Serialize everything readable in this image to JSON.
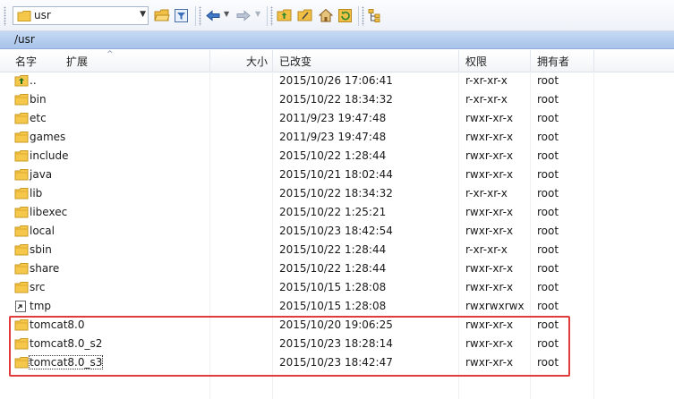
{
  "toolbar": {
    "path_value": "usr",
    "icons": [
      "folder-icon",
      "open-folder-icon",
      "filter-icon",
      "back-icon",
      "forward-icon",
      "parent-folder-icon",
      "root-folder-icon",
      "home-icon",
      "refresh-icon",
      "tree-icon"
    ]
  },
  "pathbar": {
    "path": "/usr"
  },
  "columns": {
    "name": "名字",
    "ext": "扩展",
    "size": "大小",
    "modified": "已改变",
    "perms": "权限",
    "owner": "拥有者"
  },
  "rows": [
    {
      "name": "..",
      "modified": "2015/10/26 17:06:41",
      "perms": "r-xr-xr-x",
      "owner": "root",
      "icon": "parent-folder-icon"
    },
    {
      "name": "bin",
      "modified": "2015/10/22 18:34:32",
      "perms": "r-xr-xr-x",
      "owner": "root",
      "icon": "folder-icon"
    },
    {
      "name": "etc",
      "modified": "2011/9/23 19:47:48",
      "perms": "rwxr-xr-x",
      "owner": "root",
      "icon": "folder-icon"
    },
    {
      "name": "games",
      "modified": "2011/9/23 19:47:48",
      "perms": "rwxr-xr-x",
      "owner": "root",
      "icon": "folder-icon"
    },
    {
      "name": "include",
      "modified": "2015/10/22 1:28:44",
      "perms": "rwxr-xr-x",
      "owner": "root",
      "icon": "folder-icon"
    },
    {
      "name": "java",
      "modified": "2015/10/21 18:02:44",
      "perms": "rwxr-xr-x",
      "owner": "root",
      "icon": "folder-icon"
    },
    {
      "name": "lib",
      "modified": "2015/10/22 18:34:32",
      "perms": "r-xr-xr-x",
      "owner": "root",
      "icon": "folder-icon"
    },
    {
      "name": "libexec",
      "modified": "2015/10/22 1:25:21",
      "perms": "rwxr-xr-x",
      "owner": "root",
      "icon": "folder-icon"
    },
    {
      "name": "local",
      "modified": "2015/10/23 18:42:54",
      "perms": "rwxr-xr-x",
      "owner": "root",
      "icon": "folder-icon"
    },
    {
      "name": "sbin",
      "modified": "2015/10/22 1:28:44",
      "perms": "r-xr-xr-x",
      "owner": "root",
      "icon": "folder-icon"
    },
    {
      "name": "share",
      "modified": "2015/10/22 1:28:44",
      "perms": "rwxr-xr-x",
      "owner": "root",
      "icon": "folder-icon"
    },
    {
      "name": "src",
      "modified": "2015/10/15 1:28:08",
      "perms": "rwxr-xr-x",
      "owner": "root",
      "icon": "folder-icon"
    },
    {
      "name": "tmp",
      "modified": "2015/10/15 1:28:08",
      "perms": "rwxrwxrwx",
      "owner": "root",
      "icon": "link-folder-icon"
    },
    {
      "name": "tomcat8.0",
      "modified": "2015/10/20 19:06:25",
      "perms": "rwxr-xr-x",
      "owner": "root",
      "icon": "folder-icon"
    },
    {
      "name": "tomcat8.0_s2",
      "modified": "2015/10/23 18:28:14",
      "perms": "rwxr-xr-x",
      "owner": "root",
      "icon": "folder-icon"
    },
    {
      "name": "tomcat8.0_s3",
      "modified": "2015/10/23 18:42:47",
      "perms": "rwxr-xr-x",
      "owner": "root",
      "icon": "folder-icon",
      "focused": true
    }
  ],
  "highlight_color": "#e23b3b"
}
